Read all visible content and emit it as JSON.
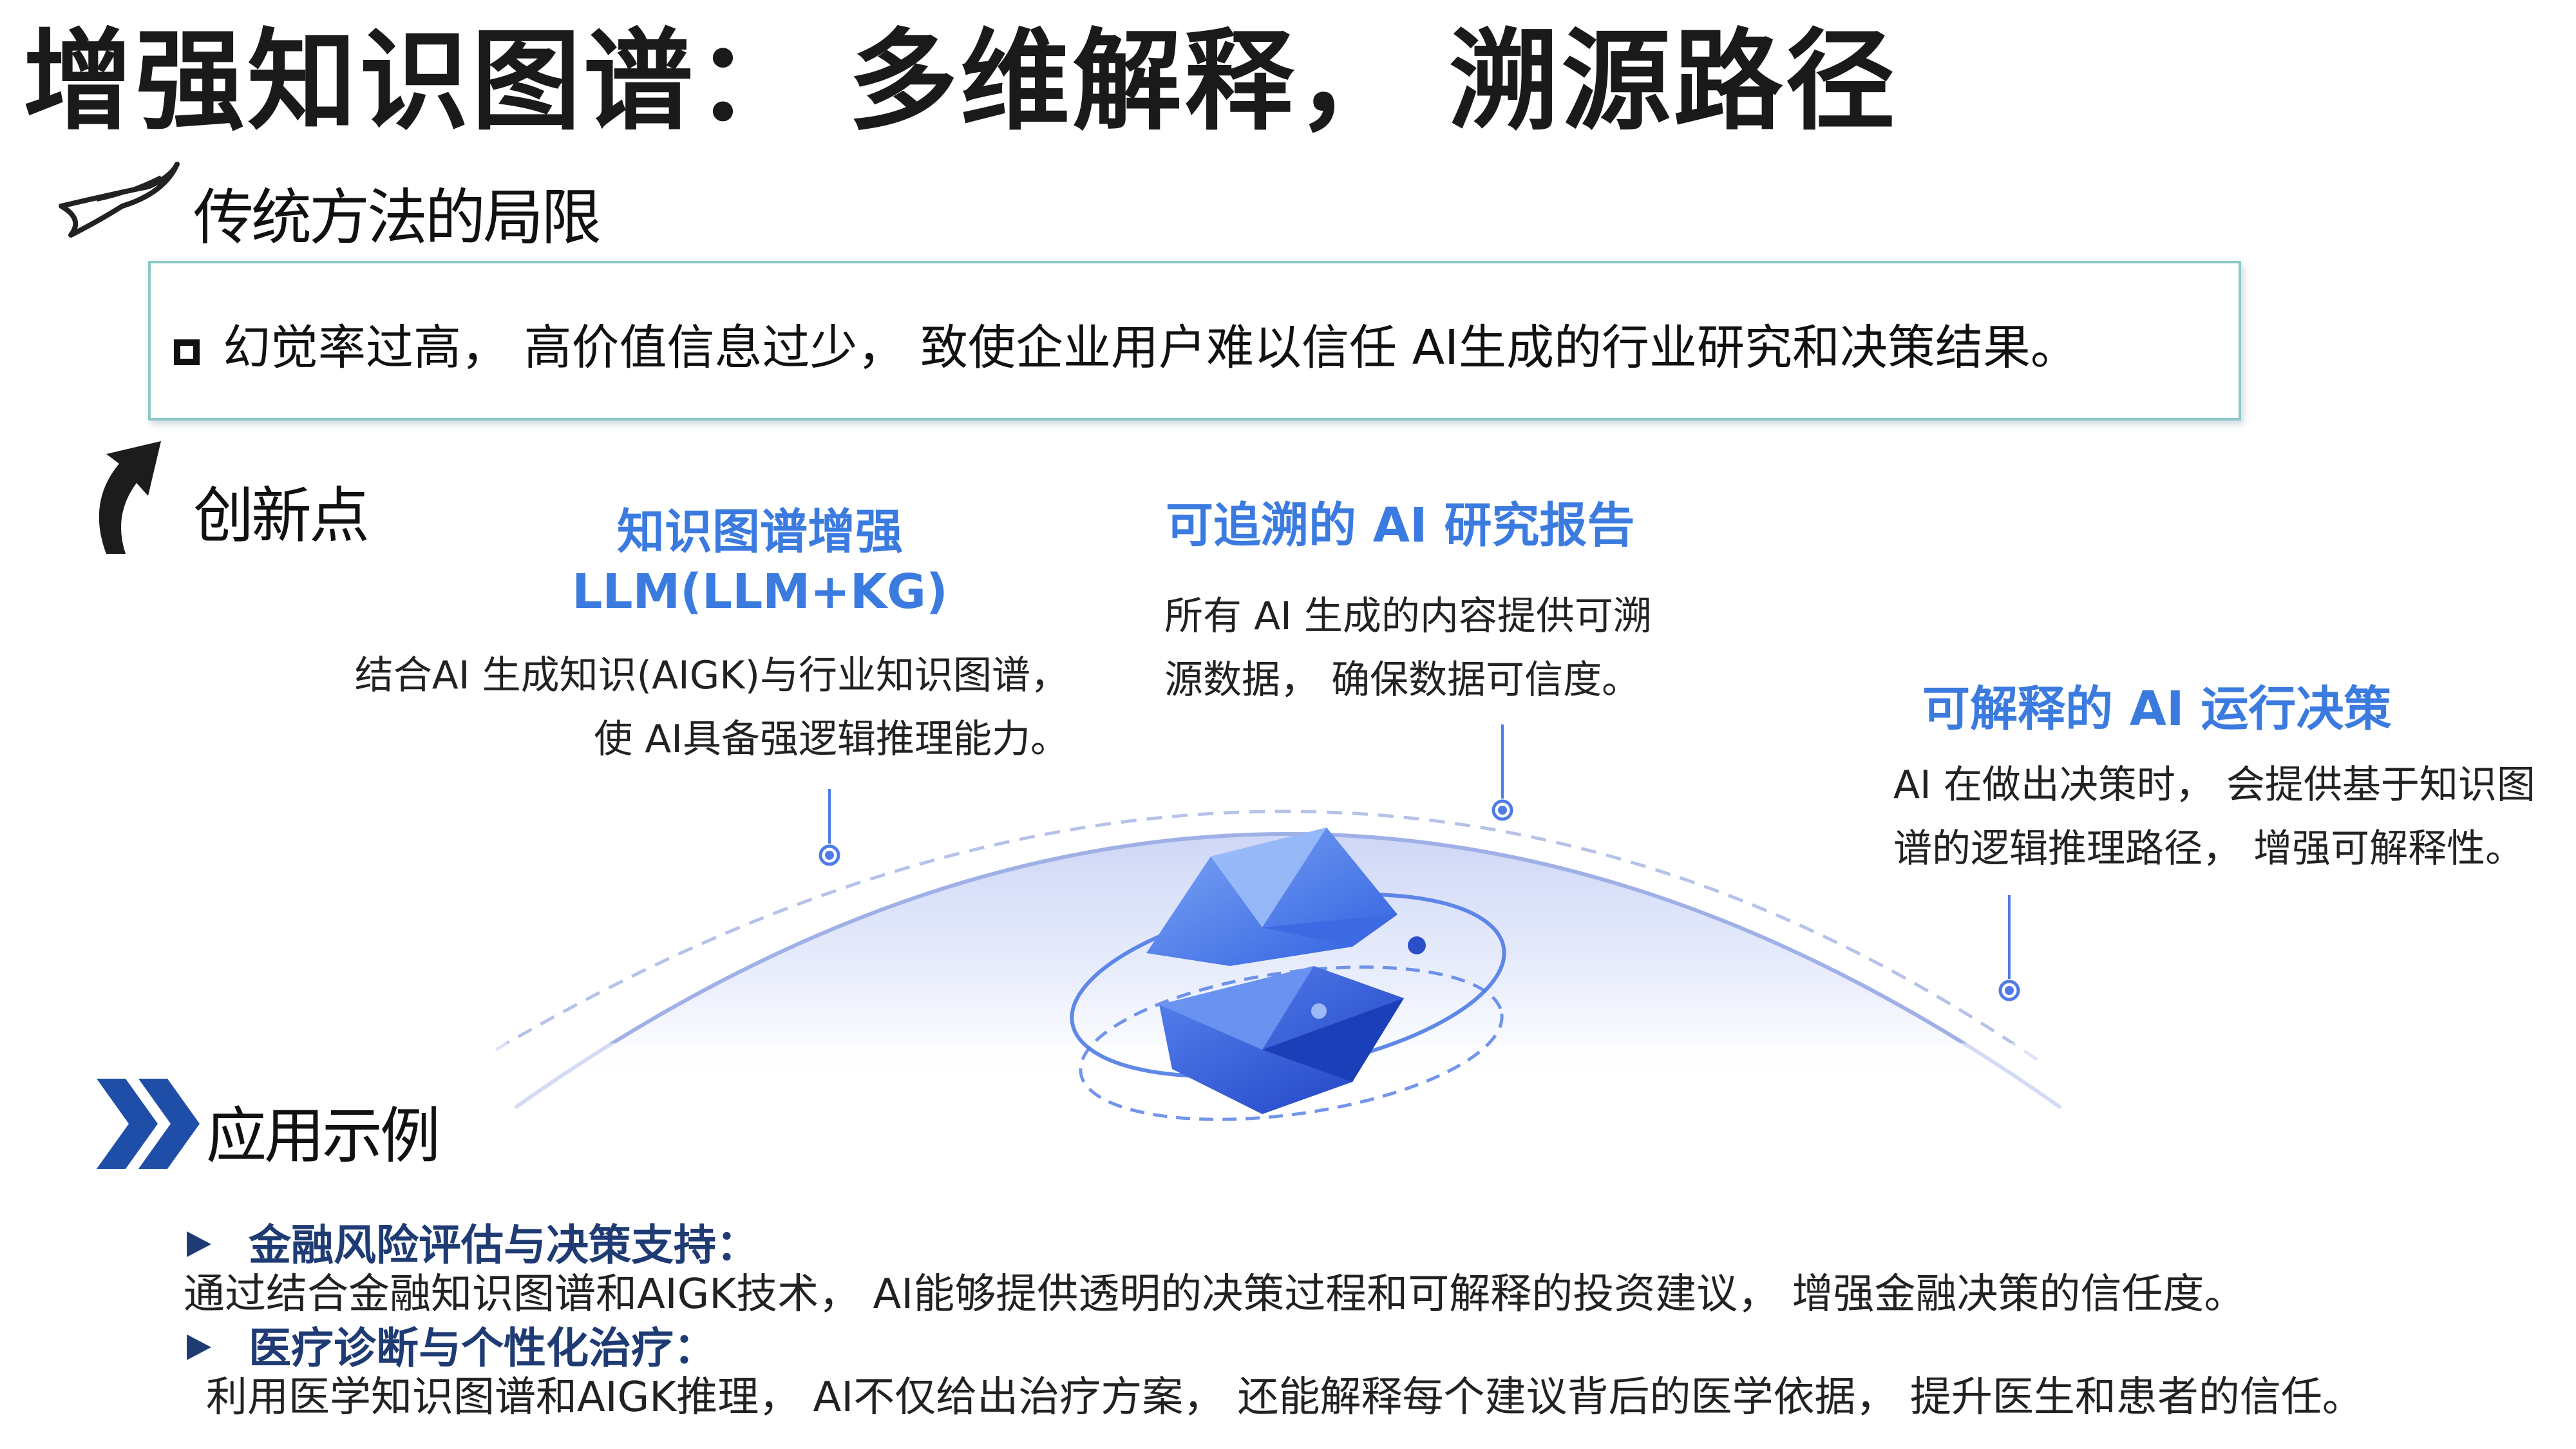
{
  "title": "增强知识图谱： 多维解释， 溯源路径",
  "sections": {
    "limitations": {
      "label": "传统方法的局限",
      "text": "幻觉率过高， 高价值信息过少， 致使企业用户难以信任 AI生成的行业研究和决策结果。"
    },
    "innovation": {
      "label": "创新点",
      "features": [
        {
          "title_line1": "知识图谱增强",
          "title_line2": "LLM(LLM+KG)",
          "desc_line1": "结合AI 生成知识(AIGK)与行业知识图谱，",
          "desc_line2": "使 AI具备强逻辑推理能力。"
        },
        {
          "title_line1": "可追溯的 AI 研究报告",
          "desc_line1": "所有 AI 生成的内容提供可溯",
          "desc_line2": "源数据， 确保数据可信度。"
        },
        {
          "title_line1": "可解释的 AI 运行决策",
          "desc_line1": "AI 在做出决策时， 会提供基于知识图",
          "desc_line2": "谱的逻辑推理路径， 增强可解释性。"
        }
      ]
    },
    "examples": {
      "label": "应用示例",
      "items": [
        {
          "heading": "金融风险评估与决策支持：",
          "desc": "通过结合金融知识图谱和AIGK技术， AI能够提供透明的决策过程和可解释的投资建议， 增强金融决策的信任度。"
        },
        {
          "heading": "医疗诊断与个性化治疗：",
          "desc": "利用医学知识图谱和AIGK推理， AI不仅给出治疗方案， 还能解释每个建议背后的医学依据， 提升医生和患者的信任。"
        }
      ]
    }
  },
  "icons": {
    "limitations": "swoosh-arrow-icon",
    "innovation": "curved-arrow-icon",
    "examples": "double-chevron-icon",
    "center": "crystal-orbit-icon"
  },
  "colors": {
    "accent_blue": "#3b7be0",
    "dark_navy": "#1f3b73",
    "box_border": "#8cc8c8"
  }
}
